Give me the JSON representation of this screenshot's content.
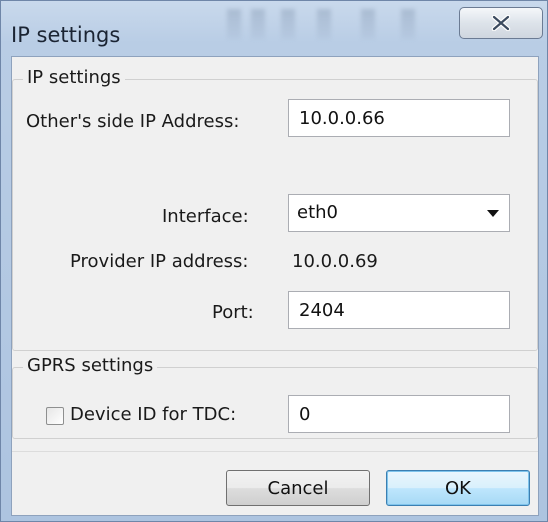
{
  "window": {
    "title": "IP settings",
    "close_icon": "close-icon"
  },
  "ip_settings": {
    "group_title": "IP settings",
    "other_side_ip_label": "Other's side IP Address:",
    "other_side_ip_value": "10.0.0.66",
    "interface_label": "Interface:",
    "interface_value": "eth0",
    "provider_ip_label": "Provider IP address:",
    "provider_ip_value": "10.0.0.69",
    "port_label": "Port:",
    "port_value": "2404"
  },
  "gprs_settings": {
    "group_title": "GPRS settings",
    "device_id_label": "Device ID for TDC:",
    "device_id_checked": false,
    "device_id_value": "0"
  },
  "buttons": {
    "cancel_label": "Cancel",
    "ok_label": "OK"
  },
  "colors": {
    "frame": "#b9cde5",
    "client_bg": "#f0f0f0",
    "default_button_border": "#3c7fb1"
  }
}
